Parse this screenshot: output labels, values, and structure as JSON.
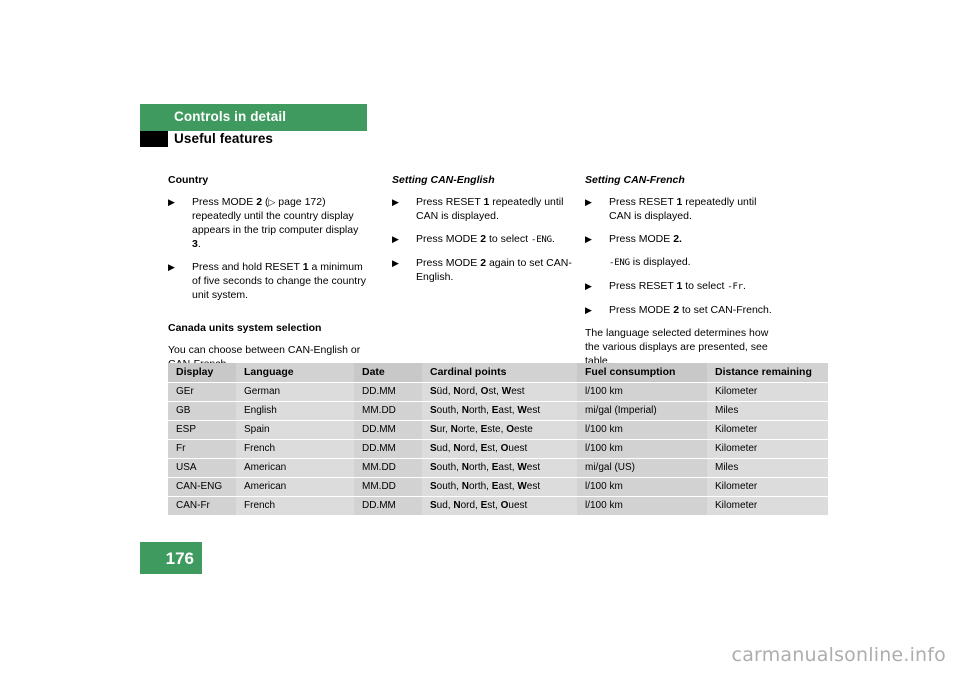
{
  "header": {
    "running_head": "Controls in detail",
    "section_title": "Useful features"
  },
  "columns": {
    "left": {
      "heading_country": "Country",
      "bullet1_pre": "Press MODE ",
      "bullet1_b1": "2",
      "bullet1_mid": " (",
      "bullet1_ref_tri": "▷",
      "bullet1_ref": " page 172) repeatedly until the country display appears in the trip computer display ",
      "bullet1_b2": "3",
      "bullet1_end": ".",
      "bullet2_pre": "Press and hold RESET ",
      "bullet2_b1": "1",
      "bullet2_end": " a minimum of five seconds to change the country unit system.",
      "heading_canada": "Canada units system selection",
      "para_canada": "You can choose between CAN-English or CAN-French."
    },
    "middle": {
      "heading": "Setting CAN-English",
      "bullet1_pre": "Press RESET ",
      "bullet1_b1": "1",
      "bullet1_end": " repeatedly until CAN is displayed.",
      "bullet2_pre": "Press MODE ",
      "bullet2_b1": "2",
      "bullet2_mid": " to select ",
      "bullet2_lcd": "-ENG",
      "bullet2_end": ".",
      "bullet3_pre": "Press MODE ",
      "bullet3_b1": "2",
      "bullet3_end": " again to set CAN-English."
    },
    "right": {
      "heading": "Setting CAN-French",
      "bullet1_pre": "Press RESET ",
      "bullet1_b1": "1",
      "bullet1_end": " repeatedly until CAN is displayed.",
      "bullet2_pre": "Press MODE ",
      "bullet2_b1": "2.",
      "note_lcd": "-ENG",
      "note_end": " is displayed.",
      "bullet3_pre": "Press RESET ",
      "bullet3_b1": "1",
      "bullet3_mid": " to select ",
      "bullet3_lcd": "-Fr",
      "bullet3_end": ".",
      "bullet4_pre": "Press MODE ",
      "bullet4_b1": "2",
      "bullet4_end": " to set CAN-French.",
      "closing_para": "The language selected determines how the various displays are presented, see table."
    }
  },
  "table": {
    "columns": [
      "Display",
      "Language",
      "Date",
      "Cardinal points",
      "Fuel consumption",
      "Distance remaining"
    ],
    "rows": [
      {
        "display": "GEr",
        "language": "German",
        "date": "DD.MM",
        "cardinal": [
          [
            "S",
            "üd"
          ],
          [
            "N",
            "ord"
          ],
          [
            "O",
            "st"
          ],
          [
            "W",
            "est"
          ]
        ],
        "fuel": "l/100 km",
        "distance": "Kilometer"
      },
      {
        "display": "GB",
        "language": "English",
        "date": "MM.DD",
        "cardinal": [
          [
            "S",
            "outh"
          ],
          [
            "N",
            "orth"
          ],
          [
            "E",
            "ast"
          ],
          [
            "W",
            "est"
          ]
        ],
        "fuel": "mi/gal (Imperial)",
        "distance": "Miles"
      },
      {
        "display": "ESP",
        "language": "Spain",
        "date": "DD.MM",
        "cardinal": [
          [
            "S",
            "ur"
          ],
          [
            "N",
            "orte"
          ],
          [
            "E",
            "ste"
          ],
          [
            "O",
            "este"
          ]
        ],
        "fuel": "l/100 km",
        "distance": "Kilometer"
      },
      {
        "display": "Fr",
        "language": "French",
        "date": "DD.MM",
        "cardinal": [
          [
            "S",
            "ud"
          ],
          [
            "N",
            "ord"
          ],
          [
            "E",
            "st"
          ],
          [
            "O",
            "uest"
          ]
        ],
        "fuel": "l/100 km",
        "distance": "Kilometer"
      },
      {
        "display": "USA",
        "language": "American",
        "date": "MM.DD",
        "cardinal": [
          [
            "S",
            "outh"
          ],
          [
            "N",
            "orth"
          ],
          [
            "E",
            "ast"
          ],
          [
            "W",
            "est"
          ]
        ],
        "fuel": "mi/gal (US)",
        "distance": "Miles"
      },
      {
        "display": "CAN-ENG",
        "language": "American",
        "date": "MM.DD",
        "cardinal": [
          [
            "S",
            "outh"
          ],
          [
            "N",
            "orth"
          ],
          [
            "E",
            "ast"
          ],
          [
            "W",
            "est"
          ]
        ],
        "fuel": "l/100 km",
        "distance": "Kilometer"
      },
      {
        "display": "CAN-Fr",
        "language": "French",
        "date": "DD.MM",
        "cardinal": [
          [
            "S",
            "ud"
          ],
          [
            "N",
            "ord"
          ],
          [
            "E",
            "st"
          ],
          [
            "O",
            "uest"
          ]
        ],
        "fuel": "l/100 km",
        "distance": "Kilometer"
      }
    ]
  },
  "footer": {
    "page_number": "176",
    "watermark": "carmanualsonline.info"
  },
  "bullet_glyph": "▶",
  "colors": {
    "brand_green": "#3E9A5E",
    "table_col_dark": "#D2D2D2",
    "table_col_light": "#DCDCDC",
    "watermark_gray": "#ADADAD"
  }
}
